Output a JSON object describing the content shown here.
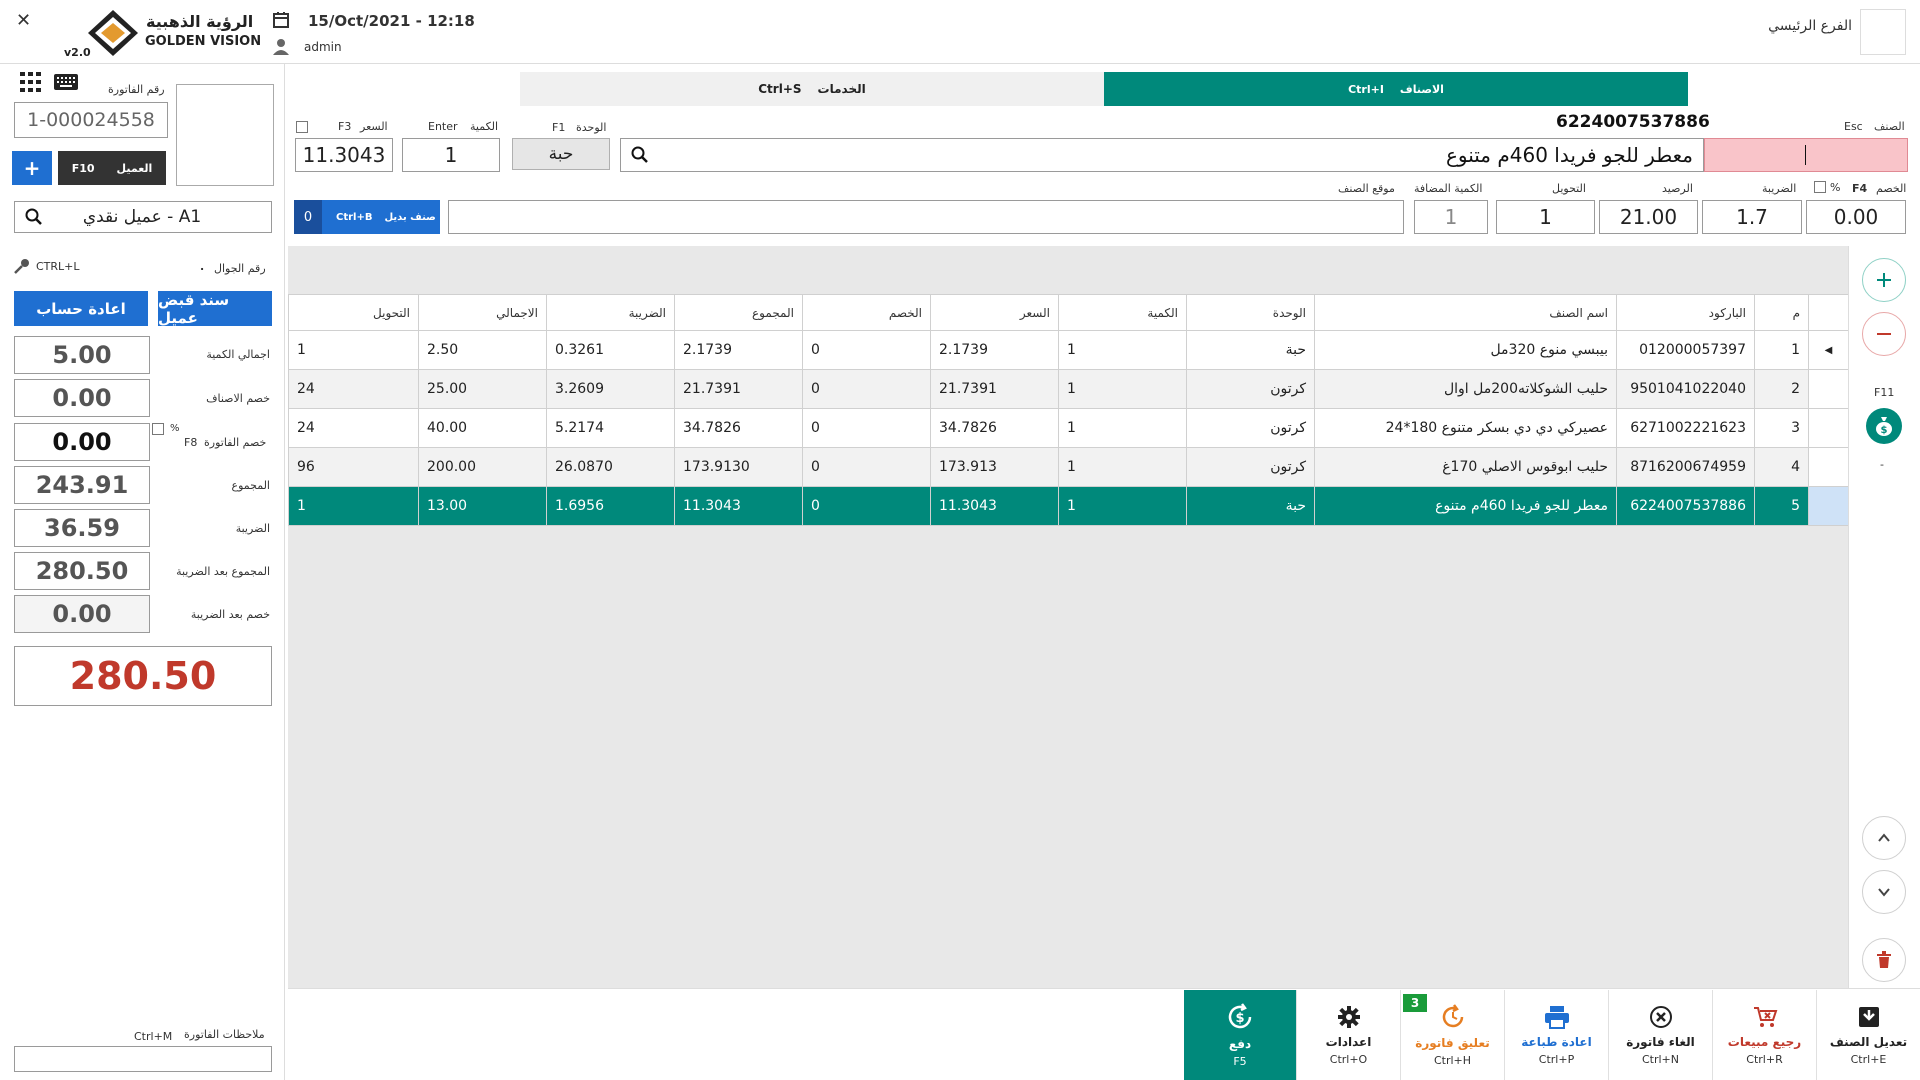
{
  "header": {
    "logo_ar": "الرؤية الذهبية",
    "logo_en": "GOLDEN VISION",
    "version": "v2.0",
    "datetime": "15/Oct/2021 - 12:18",
    "user": "admin",
    "branch": "الفرع الرئيسي"
  },
  "tabs": {
    "items": {
      "label": "الاصناف",
      "key": "Ctrl+I"
    },
    "services": {
      "label": "الخدمات",
      "key": "Ctrl+S"
    }
  },
  "entry": {
    "item_label": "الصنف",
    "item_key": "Esc",
    "barcode": "6224007537886",
    "item_name": "معطر للجو فريدا 460م متنوع",
    "unit_label": "الوحدة",
    "unit_key": "F1",
    "unit_value": "حبة",
    "qty_label": "الكمية",
    "qty_key": "Enter",
    "qty_value": "1",
    "price_label": "السعر",
    "price_key": "F3",
    "price_value": "11.3043",
    "discount_label": "الخصم",
    "discount_key": "F4",
    "discount_pct": "%",
    "discount_value": "0.00",
    "tax_label": "الضريبة",
    "tax_value": "1.7",
    "balance_label": "الرصيد",
    "balance_value": "21.00",
    "conversion_label": "التحويل",
    "conversion_value": "1",
    "added_qty_label": "الكمية المضافة",
    "added_qty_value": "1",
    "location_label": "موقع الصنف",
    "location_value": "",
    "alt_item_label": "صنف بديل",
    "alt_item_key": "Ctrl+B",
    "alt_item_count": "0"
  },
  "invoice": {
    "number_label": "رقم الفاتورة",
    "number_value": "1-000024558",
    "customer_label": "العميل",
    "customer_key": "F10",
    "add_label": "+",
    "customer_value": "عميل نقدي - A1",
    "mobile_label": "رقم الجوال",
    "mobile_value": ".",
    "ctrl_l": "CTRL+L",
    "receipt_btn": "سند قبض عميل",
    "recalc_btn": "اعادة حساب"
  },
  "summary": {
    "total_qty_label": "اجمالي الكمية",
    "total_qty": "5.00",
    "items_disc_label": "خصم الاصناف",
    "items_disc": "0.00",
    "inv_disc_label": "خصم الفاتورة",
    "inv_disc_key": "F8",
    "inv_disc_pct": "%",
    "inv_disc": "0.00",
    "sum_label": "المجموع",
    "sum": "243.91",
    "tax_label": "الضريبة",
    "tax": "36.59",
    "sum_after_tax_label": "المجموع بعد الضريبة",
    "sum_after_tax": "280.50",
    "disc_after_tax_label": "خصم بعد الضريبة",
    "disc_after_tax": "0.00",
    "grand_total": "280.50",
    "notes_label": "ملاحظات الفاتورة",
    "notes_key": "Ctrl+M"
  },
  "grid": {
    "headers": [
      "م",
      "الباركود",
      "اسم الصنف",
      "الوحدة",
      "الكمية",
      "السعر",
      "الخصم",
      "المجموع",
      "الضريبة",
      "الاجمالي",
      "التحويل"
    ],
    "rows": [
      [
        "1",
        "012000057397",
        "بيبسي منوع 320مل",
        "حبة",
        "1",
        "2.1739",
        "0",
        "2.1739",
        "0.3261",
        "2.50",
        "1"
      ],
      [
        "2",
        "9501041022040",
        "حليب الشوكلاته200مل اوال",
        "كرتون",
        "1",
        "21.7391",
        "0",
        "21.7391",
        "3.2609",
        "25.00",
        "24"
      ],
      [
        "3",
        "6271002221623",
        "عصيركي دي دي بسكر متنوع 180*24",
        "كرتون",
        "1",
        "34.7826",
        "0",
        "34.7826",
        "5.2174",
        "40.00",
        "24"
      ],
      [
        "4",
        "8716200674959",
        "حليب ابوقوس الاصلي 170غ",
        "كرتون",
        "1",
        "173.913",
        "0",
        "173.9130",
        "26.0870",
        "200.00",
        "96"
      ],
      [
        "5",
        "6224007537886",
        "معطر للجو فريدا 460م متنوع",
        "حبة",
        "1",
        "11.3043",
        "0",
        "11.3043",
        "1.6956",
        "13.00",
        "1"
      ]
    ],
    "selected_row": 4
  },
  "side": {
    "f11": "F11",
    "dash": "-"
  },
  "toolbar": [
    {
      "label": "تعديل الصنف",
      "key": "Ctrl+E",
      "icon": "edit-item-icon",
      "color": "#222"
    },
    {
      "label": "رجيع مبيعات",
      "key": "Ctrl+R",
      "icon": "cart-return-icon",
      "color": "#c0392b"
    },
    {
      "label": "الغاء فاتورة",
      "key": "Ctrl+N",
      "icon": "cancel-icon",
      "color": "#222"
    },
    {
      "label": "اعادة طباعة",
      "key": "Ctrl+P",
      "icon": "print-icon",
      "color": "#1f6fd1"
    },
    {
      "label": "تعليق فاتورة",
      "key": "Ctrl+H",
      "icon": "hold-icon",
      "color": "#e67e22",
      "badge": "3"
    },
    {
      "label": "اعدادات",
      "key": "Ctrl+O",
      "icon": "gear-icon",
      "color": "#222"
    },
    {
      "label": "دفع",
      "key": "F5",
      "icon": "pay-icon",
      "color": "#fff"
    }
  ],
  "colors": {
    "teal": "#00897b",
    "blue": "#1f6fd1",
    "total_red": "#c0392b",
    "barcode_input_bg": "#f9c4c9"
  }
}
